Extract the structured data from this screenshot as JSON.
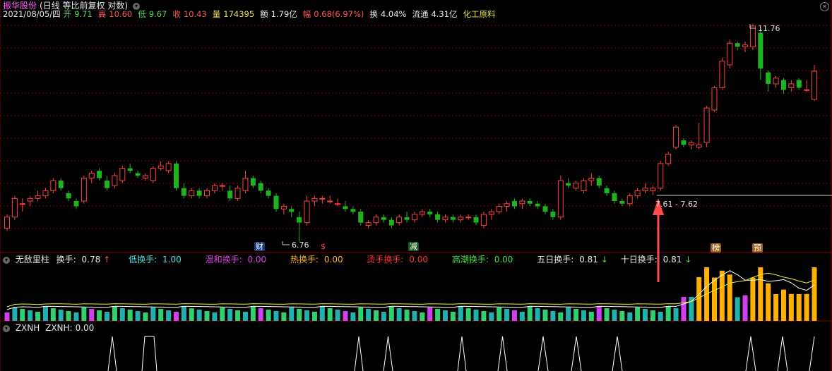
{
  "header": {
    "stock_name": "振华股份",
    "chart_mode": "(日线 等比前复权 对数)",
    "date": "2021/08/05/四",
    "open_label": "开",
    "open": "9.71",
    "high_label": "高",
    "high": "10.60",
    "low_label": "低",
    "low": "9.67",
    "close_label": "收",
    "close": "10.43",
    "volume_label": "量",
    "volume": "174395",
    "amount_label": "额",
    "amount": "1.79亿",
    "change_label": "幅",
    "change": "0.68(6.97%)",
    "turnover_label": "换",
    "turnover": "4.04%",
    "float_label": "流通",
    "float": "4.31亿",
    "industry": "化工原料"
  },
  "price_annotations": {
    "max_label": "11.76",
    "min_label": "6.76",
    "range_label": "7.61 - 7.62"
  },
  "event_badges": [
    "财",
    "$",
    "减",
    "榜",
    "预"
  ],
  "indicator1": {
    "name": "无敌里柱",
    "items": [
      {
        "label": "换手:",
        "value": "0.78",
        "arrow": "↑"
      },
      {
        "label": "低换手:",
        "value": "1.00"
      },
      {
        "label": "温和换手:",
        "value": "0.00"
      },
      {
        "label": "热换手:",
        "value": "0.00"
      },
      {
        "label": "烫手换手:",
        "value": "0.00"
      },
      {
        "label": "高潮换手:",
        "value": "0.00"
      },
      {
        "label": "五日换手:",
        "value": "0.81",
        "arrow": "↓"
      },
      {
        "label": "十日换手:",
        "value": "0.81",
        "arrow": "↓"
      }
    ]
  },
  "indicator2": {
    "name": "ZXNH",
    "label": "ZXNH:",
    "value": "0.00"
  },
  "colors": {
    "up_candle": "#ff4040",
    "down_candle": "#1fb41f",
    "grid": "#8b0000",
    "arrow": "#ff4a4a"
  },
  "chart_data": {
    "type": "candlestick",
    "series": [
      {
        "name": "price",
        "candles_ohlc": [
          [
            7.0,
            7.25,
            6.95,
            7.2
          ],
          [
            7.2,
            7.6,
            7.15,
            7.55
          ],
          [
            7.45,
            7.55,
            7.3,
            7.45
          ],
          [
            7.5,
            7.6,
            7.4,
            7.55
          ],
          [
            7.55,
            7.7,
            7.5,
            7.6
          ],
          [
            7.6,
            7.75,
            7.55,
            7.7
          ],
          [
            7.7,
            7.95,
            7.65,
            7.9
          ],
          [
            7.9,
            7.95,
            7.7,
            7.75
          ],
          [
            7.65,
            7.7,
            7.5,
            7.55
          ],
          [
            7.5,
            7.55,
            7.35,
            7.4
          ],
          [
            7.5,
            8.0,
            7.45,
            7.95
          ],
          [
            7.95,
            8.1,
            7.85,
            8.05
          ],
          [
            8.1,
            8.15,
            7.9,
            7.95
          ],
          [
            7.9,
            8.0,
            7.7,
            7.75
          ],
          [
            7.8,
            8.05,
            7.75,
            8.0
          ],
          [
            7.9,
            8.2,
            7.85,
            8.15
          ],
          [
            8.15,
            8.25,
            8.05,
            8.1
          ],
          [
            8.05,
            8.1,
            7.95,
            8.0
          ],
          [
            7.95,
            8.05,
            7.9,
            8.0
          ],
          [
            7.9,
            8.2,
            7.85,
            8.15
          ],
          [
            8.15,
            8.3,
            8.1,
            8.2
          ],
          [
            8.1,
            8.3,
            8.05,
            8.25
          ],
          [
            8.25,
            8.3,
            7.7,
            7.75
          ],
          [
            7.75,
            7.85,
            7.55,
            7.6
          ],
          [
            7.6,
            7.75,
            7.55,
            7.7
          ],
          [
            7.7,
            7.75,
            7.55,
            7.6
          ],
          [
            7.6,
            7.75,
            7.55,
            7.7
          ],
          [
            7.7,
            7.85,
            7.65,
            7.8
          ],
          [
            7.8,
            7.85,
            7.7,
            7.8
          ],
          [
            7.7,
            7.8,
            7.5,
            7.55
          ],
          [
            7.55,
            7.8,
            7.5,
            7.75
          ],
          [
            7.7,
            8.1,
            7.65,
            7.95
          ],
          [
            7.95,
            8.0,
            7.75,
            7.8
          ],
          [
            7.85,
            7.9,
            7.65,
            7.7
          ],
          [
            7.7,
            7.75,
            7.55,
            7.6
          ],
          [
            7.6,
            7.65,
            7.3,
            7.35
          ],
          [
            7.35,
            7.45,
            7.25,
            7.4
          ],
          [
            7.35,
            7.4,
            7.2,
            7.3
          ],
          [
            7.2,
            7.3,
            6.76,
            7.1
          ],
          [
            7.1,
            7.6,
            7.05,
            7.5
          ],
          [
            7.5,
            7.6,
            7.4,
            7.55
          ],
          [
            7.55,
            7.6,
            7.45,
            7.55
          ],
          [
            7.5,
            7.6,
            7.45,
            7.5
          ],
          [
            7.45,
            7.55,
            7.4,
            7.45
          ],
          [
            7.4,
            7.5,
            7.3,
            7.35
          ],
          [
            7.35,
            7.4,
            7.25,
            7.3
          ],
          [
            7.3,
            7.35,
            7.05,
            7.1
          ],
          [
            7.05,
            7.15,
            7.0,
            7.1
          ],
          [
            7.1,
            7.25,
            7.05,
            7.2
          ],
          [
            7.2,
            7.25,
            7.1,
            7.15
          ],
          [
            7.15,
            7.2,
            7.0,
            7.05
          ],
          [
            7.1,
            7.25,
            7.05,
            7.2
          ],
          [
            7.2,
            7.3,
            7.1,
            7.15
          ],
          [
            7.15,
            7.3,
            7.1,
            7.25
          ],
          [
            7.25,
            7.35,
            7.2,
            7.3
          ],
          [
            7.3,
            7.35,
            7.2,
            7.25
          ],
          [
            7.25,
            7.3,
            7.1,
            7.15
          ],
          [
            7.15,
            7.25,
            7.1,
            7.2
          ],
          [
            7.2,
            7.25,
            7.1,
            7.15
          ],
          [
            7.15,
            7.25,
            7.1,
            7.2
          ],
          [
            7.2,
            7.25,
            7.15,
            7.2
          ],
          [
            7.2,
            7.25,
            7.05,
            7.1
          ],
          [
            7.05,
            7.3,
            7.0,
            7.25
          ],
          [
            7.25,
            7.35,
            7.15,
            7.3
          ],
          [
            7.3,
            7.45,
            7.25,
            7.4
          ],
          [
            7.4,
            7.5,
            7.3,
            7.45
          ],
          [
            7.5,
            7.55,
            7.35,
            7.4
          ],
          [
            7.45,
            7.55,
            7.35,
            7.5
          ],
          [
            7.5,
            7.55,
            7.4,
            7.45
          ],
          [
            7.45,
            7.5,
            7.35,
            7.4
          ],
          [
            7.4,
            7.45,
            7.25,
            7.3
          ],
          [
            7.3,
            7.35,
            7.15,
            7.2
          ],
          [
            7.2,
            8.0,
            7.15,
            7.9
          ],
          [
            7.85,
            7.95,
            7.75,
            7.8
          ],
          [
            7.75,
            7.9,
            7.7,
            7.85
          ],
          [
            7.7,
            7.95,
            7.65,
            7.9
          ],
          [
            7.9,
            8.05,
            7.8,
            7.95
          ],
          [
            7.95,
            8.0,
            7.75,
            7.8
          ],
          [
            7.75,
            7.8,
            7.6,
            7.65
          ],
          [
            7.65,
            7.7,
            7.45,
            7.5
          ],
          [
            7.5,
            7.55,
            7.4,
            7.45
          ],
          [
            7.45,
            7.65,
            7.4,
            7.6
          ],
          [
            7.6,
            7.75,
            7.55,
            7.7
          ],
          [
            7.7,
            7.85,
            7.65,
            7.75
          ],
          [
            7.7,
            7.8,
            7.61,
            7.75
          ],
          [
            7.75,
            8.3,
            7.7,
            8.25
          ],
          [
            8.25,
            8.5,
            8.2,
            8.45
          ],
          [
            8.6,
            9.1,
            8.55,
            9.05
          ],
          [
            8.75,
            8.8,
            8.6,
            8.65
          ],
          [
            8.65,
            8.75,
            8.55,
            8.7
          ],
          [
            8.6,
            9.15,
            8.55,
            8.65
          ],
          [
            8.7,
            9.55,
            8.6,
            9.5
          ],
          [
            9.45,
            10.05,
            9.4,
            10.0
          ],
          [
            10.0,
            10.8,
            9.95,
            10.7
          ],
          [
            10.6,
            11.3,
            10.5,
            11.2
          ],
          [
            11.2,
            11.25,
            11.0,
            11.1
          ],
          [
            11.1,
            11.25,
            10.95,
            11.15
          ],
          [
            11.1,
            11.76,
            11.0,
            11.7
          ],
          [
            11.5,
            11.6,
            10.2,
            10.5
          ],
          [
            10.4,
            10.45,
            9.9,
            10.1
          ],
          [
            10.1,
            10.3,
            10.0,
            10.25
          ],
          [
            10.2,
            10.25,
            9.85,
            9.95
          ],
          [
            10.0,
            10.2,
            9.9,
            10.1
          ],
          [
            10.2,
            10.25,
            9.95,
            10.0
          ],
          [
            9.95,
            10.2,
            9.9,
            9.95
          ],
          [
            9.71,
            10.6,
            9.67,
            10.43
          ]
        ]
      }
    ]
  }
}
